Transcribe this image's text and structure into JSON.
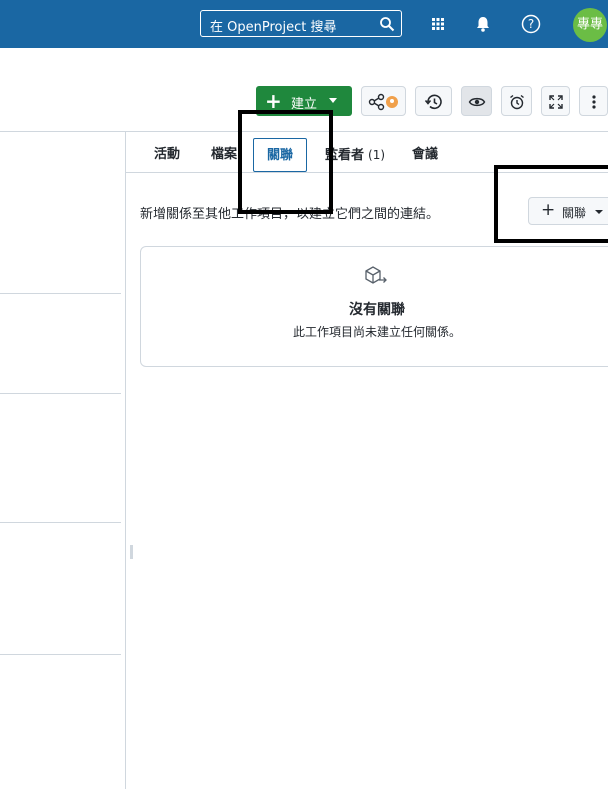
{
  "header": {
    "search_placeholder": "在 OpenProject 搜尋",
    "avatar_initials": "專專",
    "bg_color": "#1a67a3"
  },
  "toolbar": {
    "create_label": "建立",
    "create_color": "#1f883d",
    "buttons": [
      "share-icon",
      "history-icon",
      "watch-icon",
      "reminder-icon",
      "fullscreen-icon",
      "more-icon"
    ]
  },
  "tabs": [
    {
      "label": "活動"
    },
    {
      "label": "檔案"
    },
    {
      "label": "關聯",
      "selected": true
    },
    {
      "label": "監看者",
      "count": "(1)"
    },
    {
      "label": "會議"
    }
  ],
  "relations": {
    "description": "新增關係至其他工作項目，以建立它們之間的連結。",
    "add_button_label": "關聯",
    "empty_title": "沒有關聯",
    "empty_text": "此工作項目尚未建立任何關係。"
  }
}
